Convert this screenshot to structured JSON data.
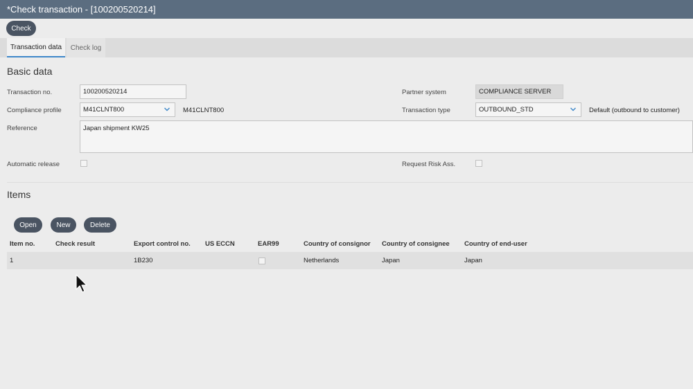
{
  "window": {
    "title": "*Check transaction - [100200520214]"
  },
  "toolbar": {
    "check_label": "Check"
  },
  "tabs": [
    {
      "label": "Transaction data",
      "active": true
    },
    {
      "label": "Check log",
      "active": false
    }
  ],
  "basic_data": {
    "title": "Basic data",
    "transaction_no_label": "Transaction no.",
    "transaction_no_value": "100200520214",
    "compliance_profile_label": "Compliance profile",
    "compliance_profile_value": "M41CLNT800",
    "compliance_profile_desc": "M41CLNT800",
    "reference_label": "Reference",
    "reference_value": "Japan shipment KW25",
    "automatic_release_label": "Automatic release",
    "automatic_release_checked": false,
    "partner_system_label": "Partner system",
    "partner_system_value": "COMPLIANCE SERVER",
    "transaction_type_label": "Transaction type",
    "transaction_type_value": "OUTBOUND_STD",
    "transaction_type_desc": "Default (outbound to customer)",
    "request_risk_label": "Request Risk Ass.",
    "request_risk_checked": false
  },
  "items": {
    "title": "Items",
    "buttons": {
      "open": "Open",
      "new": "New",
      "delete": "Delete"
    },
    "columns": [
      "Item no.",
      "Check result",
      "Export control no.",
      "US ECCN",
      "EAR99",
      "Country of consignor",
      "Country of consignee",
      "Country of end-user"
    ],
    "rows": [
      {
        "item_no": "1",
        "check_result": "",
        "export_control_no": "1B230",
        "us_eccn": "",
        "ear99": false,
        "consignor": "Netherlands",
        "consignee": "Japan",
        "end_user": "Japan"
      }
    ]
  },
  "icons": {
    "dropdown": "chevron-down-icon",
    "cursor": "mouse-pointer-icon"
  },
  "colors": {
    "titlebar": "#5b6d80",
    "button": "#4a5462",
    "tab_accent": "#3d87c9",
    "chevron": "#3d87c9"
  }
}
